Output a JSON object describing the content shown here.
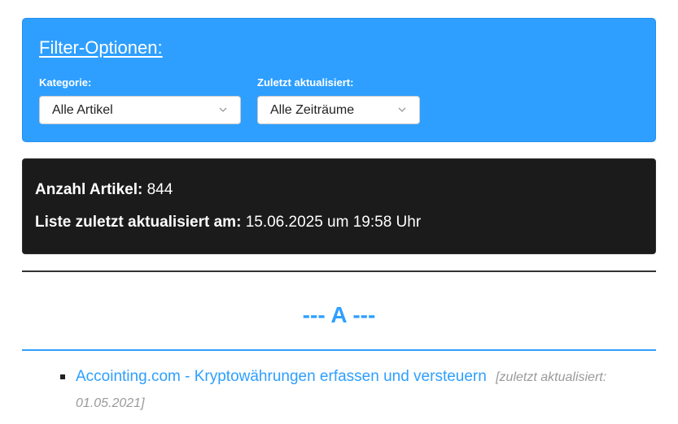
{
  "filter": {
    "title": "Filter-Optionen:",
    "category": {
      "label": "Kategorie:",
      "selected": "Alle Artikel"
    },
    "updated": {
      "label": "Zuletzt aktualisiert:",
      "selected": "Alle Zeiträume"
    }
  },
  "info": {
    "count_label": "Anzahl Artikel:",
    "count_value": "844",
    "updated_label": "Liste zuletzt aktualisiert am:",
    "updated_value": "15.06.2025 um 19:58 Uhr"
  },
  "section": {
    "heading": "--- A ---"
  },
  "articles": [
    {
      "title": "Accointing.com - Kryptowährungen erfassen und versteuern",
      "meta": "[zuletzt aktualisiert: 01.05.2021]"
    }
  ],
  "colors": {
    "accent": "#2e9fff",
    "info_bg": "#1b1b1b",
    "meta_text": "#9a9a9a"
  },
  "icons": {
    "dropdown": "chevron-down-icon"
  }
}
